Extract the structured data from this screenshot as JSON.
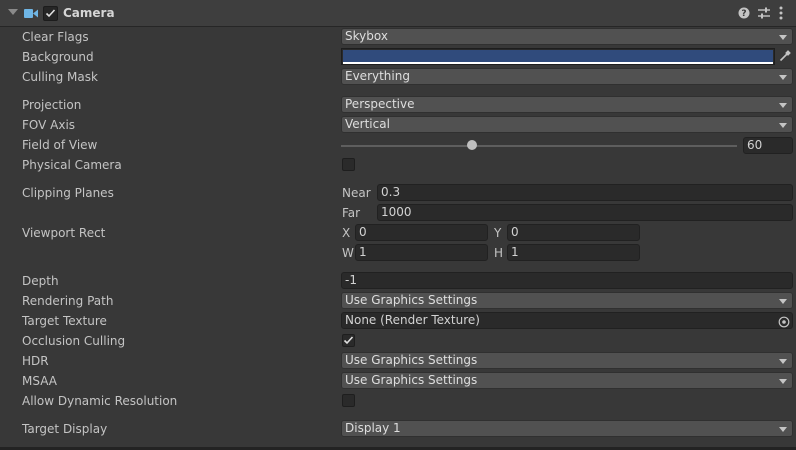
{
  "component": {
    "title": "Camera",
    "enabled": true,
    "icon": "camera-icon"
  },
  "header_icons": [
    "help-icon",
    "presets-icon",
    "context-menu-icon"
  ],
  "fields": {
    "clear_flags": {
      "label": "Clear Flags",
      "value": "Skybox"
    },
    "background": {
      "label": "Background",
      "color": "#304b7c"
    },
    "culling_mask": {
      "label": "Culling Mask",
      "value": "Everything"
    },
    "projection": {
      "label": "Projection",
      "value": "Perspective"
    },
    "fov_axis": {
      "label": "FOV Axis",
      "value": "Vertical"
    },
    "field_of_view": {
      "label": "Field of View",
      "value": "60",
      "fraction": 0.33
    },
    "physical_camera": {
      "label": "Physical Camera",
      "checked": false
    },
    "clipping_planes": {
      "label": "Clipping Planes",
      "near_label": "Near",
      "near": "0.3",
      "far_label": "Far",
      "far": "1000"
    },
    "viewport_rect": {
      "label": "Viewport Rect",
      "x_label": "X",
      "x": "0",
      "y_label": "Y",
      "y": "0",
      "w_label": "W",
      "w": "1",
      "h_label": "H",
      "h": "1"
    },
    "depth": {
      "label": "Depth",
      "value": "-1"
    },
    "rendering_path": {
      "label": "Rendering Path",
      "value": "Use Graphics Settings"
    },
    "target_texture": {
      "label": "Target Texture",
      "value": "None (Render Texture)"
    },
    "occlusion_culling": {
      "label": "Occlusion Culling",
      "checked": true
    },
    "hdr": {
      "label": "HDR",
      "value": "Use Graphics Settings"
    },
    "msaa": {
      "label": "MSAA",
      "value": "Use Graphics Settings"
    },
    "allow_dynamic_resolution": {
      "label": "Allow Dynamic Resolution",
      "checked": false
    },
    "target_display": {
      "label": "Target Display",
      "value": "Display 1"
    }
  }
}
